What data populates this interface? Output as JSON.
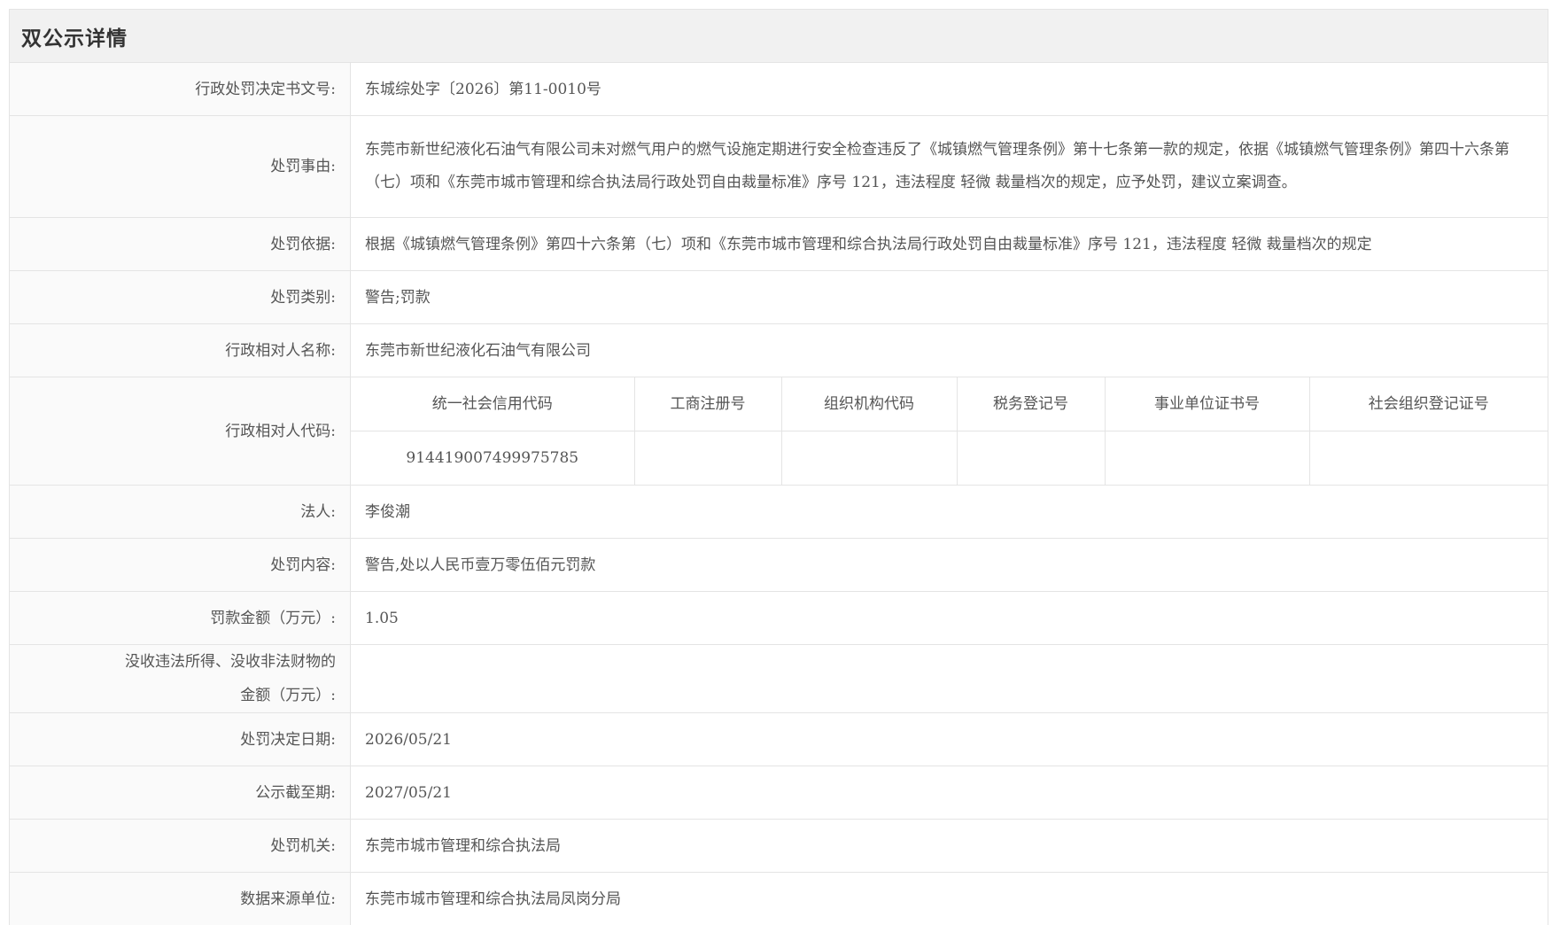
{
  "header": {
    "title": "双公示详情"
  },
  "rows": {
    "doc_number": {
      "label": "行政处罚决定书文号:",
      "value": "东城综处字〔2026〕第11-0010号"
    },
    "reason": {
      "label": "处罚事由:",
      "value": "东莞市新世纪液化石油气有限公司未对燃气用户的燃气设施定期进行安全检查违反了《城镇燃气管理条例》第十七条第一款的规定，依据《城镇燃气管理条例》第四十六条第（七）项和《东莞市城市管理和综合执法局行政处罚自由裁量标准》序号 121，违法程度 轻微 裁量档次的规定，应予处罚，建议立案调查。"
    },
    "basis": {
      "label": "处罚依据:",
      "value": "根据《城镇燃气管理条例》第四十六条第（七）项和《东莞市城市管理和综合执法局行政处罚自由裁量标准》序号 121，违法程度 轻微 裁量档次的规定"
    },
    "category": {
      "label": "处罚类别:",
      "value": "警告;罚款"
    },
    "party_name": {
      "label": "行政相对人名称:",
      "value": "东莞市新世纪液化石油气有限公司"
    },
    "party_code": {
      "label": "行政相对人代码:",
      "headers": [
        "统一社会信用代码",
        "工商注册号",
        "组织机构代码",
        "税务登记号",
        "事业单位证书号",
        "社会组织登记证号"
      ],
      "values": [
        "914419007499975785",
        "",
        "",
        "",
        "",
        ""
      ]
    },
    "legal_person": {
      "label": "法人:",
      "value": "李俊潮"
    },
    "content": {
      "label": "处罚内容:",
      "value": "警告,处以人民币壹万零伍佰元罚款"
    },
    "fine": {
      "label": "罚款金额（万元）:",
      "value": "1.05"
    },
    "confiscation": {
      "label_line1": "没收违法所得、没收非法财物的",
      "label_line2": "金额（万元）:",
      "value": ""
    },
    "decision_date": {
      "label": "处罚决定日期:",
      "value": "2026/05/21"
    },
    "publish_until": {
      "label": "公示截至期:",
      "value": "2027/05/21"
    },
    "authority": {
      "label": "处罚机关:",
      "value": "东莞市城市管理和综合执法局"
    },
    "source_unit": {
      "label": "数据来源单位:",
      "value": "东莞市城市管理和综合执法局凤岗分局"
    }
  }
}
